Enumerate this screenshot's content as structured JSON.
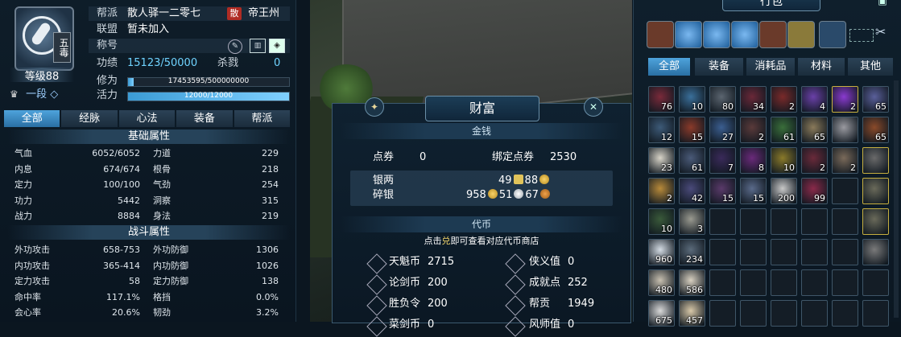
{
  "character": {
    "sect_badge": "五毒",
    "level": "等级88",
    "rank": "一段",
    "rank_icon": "◇",
    "info": [
      {
        "k": "帮派",
        "v": "散人驿一二零七",
        "badge": "散",
        "server": "帝王州"
      },
      {
        "k": "联盟",
        "v": "暂未加入"
      },
      {
        "k": "称号",
        "v": ""
      },
      {
        "k": "功绩",
        "v": "15123/50000",
        "kill_label": "杀戮",
        "kill_value": "0"
      }
    ],
    "cultivation": {
      "label": "修为",
      "text": "17453595/500000000",
      "fraction": 0.035
    },
    "vitality": {
      "label": "活力",
      "text": "12000/12000",
      "fraction": 1.0
    },
    "tabs": [
      "全部",
      "经脉",
      "心法",
      "装备",
      "帮派"
    ],
    "active_tab": 0,
    "basic_title": "基础属性",
    "basic": [
      {
        "k": "气血",
        "v": "6052/6052",
        "k2": "力道",
        "v2": "229"
      },
      {
        "k": "内息",
        "v": "674/674",
        "k2": "根骨",
        "v2": "218"
      },
      {
        "k": "定力",
        "v": "100/100",
        "k2": "气劲",
        "v2": "254"
      },
      {
        "k": "功力",
        "v": "5442",
        "k2": "洞察",
        "v2": "315"
      },
      {
        "k": "战力",
        "v": "8884",
        "k2": "身法",
        "v2": "219"
      }
    ],
    "combat_title": "战斗属性",
    "combat": [
      {
        "k": "外功攻击",
        "v": "658-753",
        "k2": "外功防御",
        "v2": "1306"
      },
      {
        "k": "内功攻击",
        "v": "365-414",
        "k2": "内功防御",
        "v2": "1026"
      },
      {
        "k": "定力攻击",
        "v": "58",
        "k2": "定力防御",
        "v2": "138"
      },
      {
        "k": "命中率",
        "v": "117.1%",
        "k2": "格挡",
        "v2": "0.0%"
      },
      {
        "k": "会心率",
        "v": "20.6%",
        "k2": "韧劲",
        "v2": "3.2%"
      }
    ]
  },
  "wealth": {
    "title": "财富",
    "money_title": "金钱",
    "points_label": "点券",
    "points_value": "0",
    "bound_points_label": "绑定点券",
    "bound_points_value": "2530",
    "silver_label": "银两",
    "silver_value": "49",
    "silver_value2": "88",
    "broken_silver_label": "碎银",
    "broken_gold": "958",
    "broken_silver": "51",
    "broken_copper": "67",
    "token_title": "代币",
    "token_hint_pre": "点击",
    "token_hint_key": "兑",
    "token_hint_post": "即可查看对应代币商店",
    "tokens": [
      {
        "k": "天魁币",
        "v": "2715",
        "k2": "侠义值",
        "v2": "0"
      },
      {
        "k": "论剑币",
        "v": "200",
        "k2": "成就点",
        "v2": "252"
      },
      {
        "k": "胜负令",
        "v": "200",
        "k2": "帮贡",
        "v2": "1949"
      },
      {
        "k": "菜剑币",
        "v": "0",
        "k2": "风师值",
        "v2": "0"
      }
    ]
  },
  "bag": {
    "title": "行包",
    "tabs": [
      "全部",
      "装备",
      "消耗品",
      "材料",
      "其他"
    ],
    "active_tab": 0,
    "slots": [
      {
        "c": "#7a2a3a",
        "n": "76"
      },
      {
        "c": "#3a6f9a",
        "n": "10"
      },
      {
        "c": "#5b6570",
        "n": "80"
      },
      {
        "c": "#6a2838",
        "n": "34"
      },
      {
        "c": "#7a2a2a",
        "n": "2"
      },
      {
        "c": "#6a40a8",
        "n": "4"
      },
      {
        "c": "#8a3ad0",
        "n": "2",
        "gold": true
      },
      {
        "c": "#5a5f9a",
        "n": "65"
      },
      {
        "c": "#3d5a78",
        "n": "12"
      },
      {
        "c": "#8a3a2a",
        "n": "15"
      },
      {
        "c": "#3b5e90",
        "n": "27"
      },
      {
        "c": "#5a3a3a",
        "n": "2"
      },
      {
        "c": "#3a6e3a",
        "n": "61"
      },
      {
        "c": "#8a7a5a",
        "n": "65"
      },
      {
        "c": "#9a9aa0",
        "n": ""
      },
      {
        "c": "#8a4a2a",
        "n": "65"
      },
      {
        "c": "#d8d4c8",
        "n": "23"
      },
      {
        "c": "#4a5a78",
        "n": "61"
      },
      {
        "c": "#3a2a5a",
        "n": "7"
      },
      {
        "c": "#6a2a7a",
        "n": "8"
      },
      {
        "c": "#8a7a2a",
        "n": "10"
      },
      {
        "c": "#6a2a3a",
        "n": "2"
      },
      {
        "c": "#7a6a5a",
        "n": "2"
      },
      {
        "c": "#6a6a6a",
        "n": "",
        "gold": true
      },
      {
        "c": "#b88a3a",
        "n": "2"
      },
      {
        "c": "#4a4a7a",
        "n": "42"
      },
      {
        "c": "#5a3a6a",
        "n": "15"
      },
      {
        "c": "#5a6a8a",
        "n": "15"
      },
      {
        "c": "#c8c8c8",
        "n": "200"
      },
      {
        "c": "#8a2a4a",
        "n": "99"
      },
      {
        "c": "",
        "n": ""
      },
      {
        "c": "#6a6a5a",
        "n": "",
        "gold": true
      },
      {
        "c": "#3a5a3a",
        "n": "10"
      },
      {
        "c": "#9a9a90",
        "n": "3"
      },
      {
        "c": "",
        "n": ""
      },
      {
        "c": "",
        "n": ""
      },
      {
        "c": "",
        "n": ""
      },
      {
        "c": "",
        "n": ""
      },
      {
        "c": "",
        "n": ""
      },
      {
        "c": "#6a6a5a",
        "n": "",
        "gold": true
      },
      {
        "c": "#d4dce4",
        "n": "960"
      },
      {
        "c": "#5a6a7a",
        "n": "234"
      },
      {
        "c": "",
        "n": ""
      },
      {
        "c": "",
        "n": ""
      },
      {
        "c": "",
        "n": ""
      },
      {
        "c": "",
        "n": ""
      },
      {
        "c": "",
        "n": ""
      },
      {
        "c": "#7a7a7a",
        "n": ""
      },
      {
        "c": "#c8c0b0",
        "n": "480"
      },
      {
        "c": "#d8d0c0",
        "n": "586"
      },
      {
        "c": "",
        "n": ""
      },
      {
        "c": "",
        "n": ""
      },
      {
        "c": "",
        "n": ""
      },
      {
        "c": "",
        "n": ""
      },
      {
        "c": "",
        "n": ""
      },
      {
        "c": "",
        "n": ""
      },
      {
        "c": "#d8d8d8",
        "n": "675"
      },
      {
        "c": "#d8c8a8",
        "n": "457"
      },
      {
        "c": "",
        "n": ""
      },
      {
        "c": "",
        "n": ""
      },
      {
        "c": "",
        "n": ""
      },
      {
        "c": "",
        "n": ""
      },
      {
        "c": "",
        "n": ""
      },
      {
        "c": "",
        "n": ""
      }
    ]
  },
  "colors": {
    "accent": "#4ea3dc",
    "panel": "#0e1d29",
    "gold_border": "#c7b040"
  }
}
